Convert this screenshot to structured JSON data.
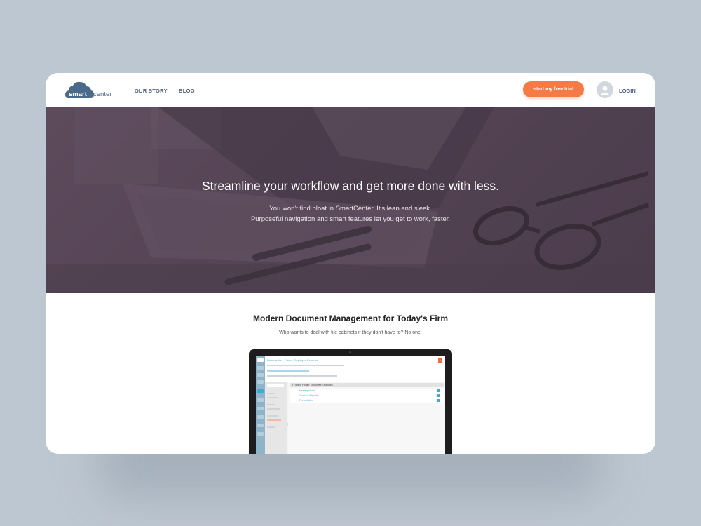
{
  "brand": {
    "logo_word1": "smart",
    "logo_word2": "center"
  },
  "nav": {
    "our_story": "OUR STORY",
    "blog": "BLOG"
  },
  "header": {
    "cta_label": "start my free trial",
    "login_label": "LOGIN"
  },
  "hero": {
    "title": "Streamline your workflow and get more done with less.",
    "subtitle_line1": "You won't find bloat in SmartCenter. It's lean and sleek.",
    "subtitle_line2": "Purposeful navigation and smart features let you get to work, faster."
  },
  "section": {
    "title": "Modern Document Management for Today's Firm",
    "subtitle": "Who wants to deal with file cabinets if they don't have to? No one."
  },
  "mockup": {
    "breadcrumb": "Documents > Folder: Employee Expense",
    "folder_bar": "3 Files in Folder: Employee Expenses",
    "files": [
      "Meeting Notes",
      "Contract Reports",
      "Presentation"
    ]
  },
  "colors": {
    "accent": "#f47b45",
    "nav_text": "#4a5f7a",
    "hero_overlay": "#5d4c5c",
    "page_background": "#bdc7d1"
  }
}
